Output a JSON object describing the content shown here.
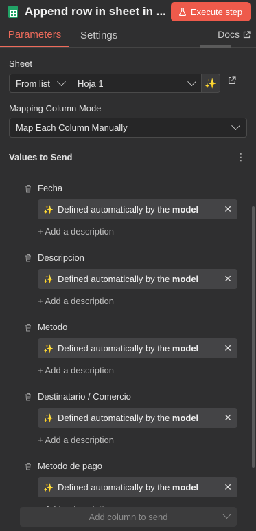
{
  "header": {
    "title": "Append row in sheet in ...",
    "execute_label": "Execute step"
  },
  "tabs": [
    {
      "label": "Parameters"
    },
    {
      "label": "Settings"
    }
  ],
  "docs_label": "Docs",
  "sheet": {
    "label": "Sheet",
    "mode": "From list",
    "value": "Hoja 1"
  },
  "mapping": {
    "label": "Mapping Column Mode",
    "value": "Map Each Column Manually"
  },
  "values_to_send": {
    "label": "Values to Send",
    "fields": [
      {
        "name": "Fecha",
        "value_prefix": "Defined automatically by the ",
        "value_bold": "model",
        "add_description": "+ Add a description"
      },
      {
        "name": "Descripcion",
        "value_prefix": "Defined automatically by the ",
        "value_bold": "model",
        "add_description": "+ Add a description"
      },
      {
        "name": "Metodo",
        "value_prefix": "Defined automatically by the ",
        "value_bold": "model",
        "add_description": "+ Add a description"
      },
      {
        "name": "Destinatario / Comercio",
        "value_prefix": "Defined automatically by the ",
        "value_bold": "model",
        "add_description": "+ Add a description"
      },
      {
        "name": "Metodo de pago",
        "value_prefix": "Defined automatically by the ",
        "value_bold": "model",
        "add_description": "+ Add a description"
      }
    ],
    "add_column_label": "Add column to send"
  },
  "colors": {
    "accent": "#ee5a4b",
    "background": "#2f2f30",
    "sheets_green": "#21a366"
  }
}
